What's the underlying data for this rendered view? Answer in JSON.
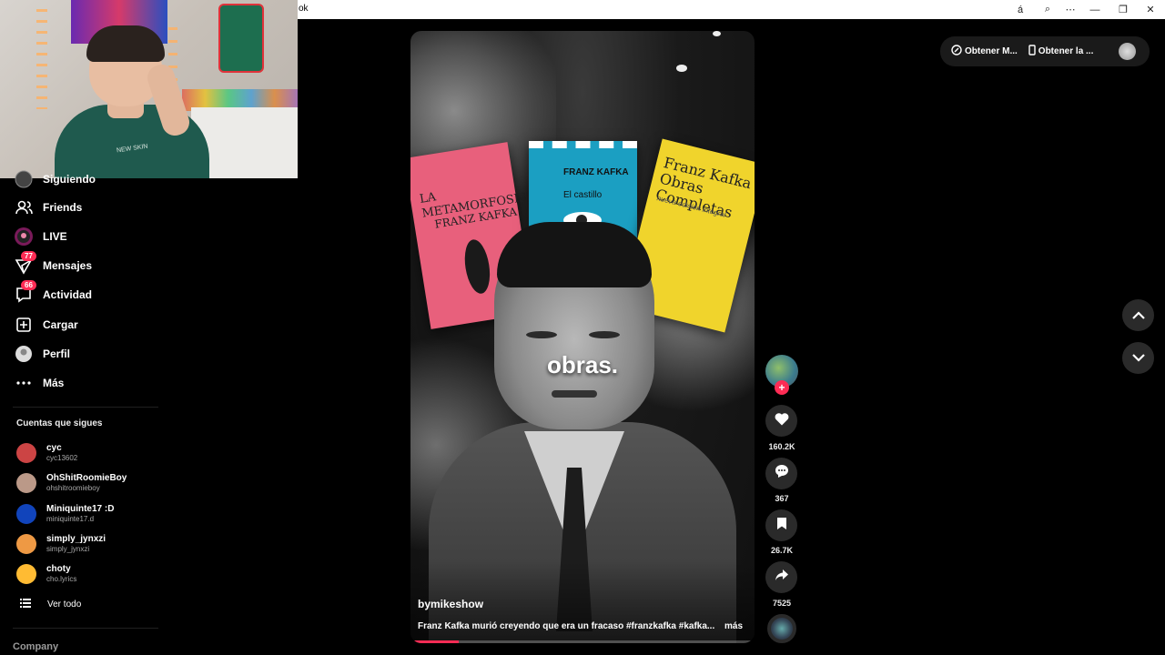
{
  "window": {
    "title": "ok",
    "buttons": {
      "translate": "á",
      "zoom": "⌕",
      "more": "⋯",
      "minimize": "—",
      "restore": "❐",
      "close": "✕"
    }
  },
  "webcam": {
    "shirt_text": "NEW SKIN"
  },
  "sidebar": {
    "items": [
      {
        "label": "Siguiendo",
        "icon": "following-avatar-icon"
      },
      {
        "label": "Friends",
        "icon": "friends-icon"
      },
      {
        "label": "LIVE",
        "icon": "live-icon"
      },
      {
        "label": "Mensajes",
        "icon": "messages-icon",
        "badge": "77"
      },
      {
        "label": "Actividad",
        "icon": "activity-icon",
        "badge": "66"
      },
      {
        "label": "Cargar",
        "icon": "upload-icon"
      },
      {
        "label": "Perfil",
        "icon": "profile-avatar-icon"
      },
      {
        "label": "Más",
        "icon": "more-icon"
      }
    ],
    "following_title": "Cuentas que sigues",
    "following": [
      {
        "name": "cyc",
        "username": "cyc13602",
        "color": "#c44"
      },
      {
        "name": "OhShitRoomieBoy",
        "username": "ohshitroomieboy",
        "color": "#b98"
      },
      {
        "name": "Miniquinte17 :D",
        "username": "miniquinte17.d",
        "color": "#14b"
      },
      {
        "name": "simply_jynxzi",
        "username": "simply_jynxzi",
        "color": "#e94"
      },
      {
        "name": "choty",
        "username": "cho.lyrics",
        "color": "#fb3"
      }
    ],
    "see_all": "Ver todo",
    "company": "Company"
  },
  "video": {
    "caption": "obras.",
    "author": "bymikeshow",
    "description": "Franz Kafka murió creyendo que era un fracaso #franzkafka #kafka...",
    "more": "más",
    "progress": 0.14,
    "books": {
      "pink_title": "LA METAMORFOSIS",
      "pink_author": "FRANZ KAFKA",
      "blue_author": "FRANZ KAFKA",
      "blue_title": "El castillo",
      "yellow_title": "Franz Kafka Obras Completas",
      "yellow_sub": "nueva edición integral"
    }
  },
  "actions": {
    "likes": "160.2K",
    "comments": "367",
    "saves": "26.7K",
    "shares": "7525",
    "follow_plus": "+"
  },
  "topbar": {
    "btn1": "Obtener M...",
    "btn2": "Obtener la ..."
  },
  "colors": {
    "accent": "#fe2c55",
    "background": "#000000",
    "panel": "#2a2a2a"
  }
}
